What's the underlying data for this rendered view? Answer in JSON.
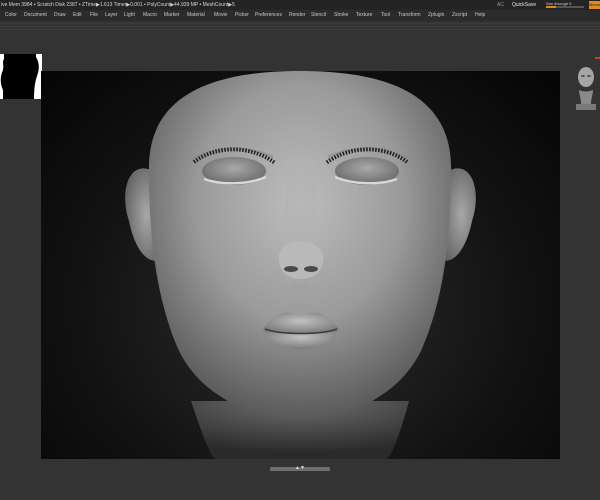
{
  "status_bar": {
    "text": "ive Mem 3984 • Scratch Disk 2387 • ZTime▶1.613 Timer▶0.001 • PolyCount▶44.939 MP • MeshCount▶5",
    "ac_label": "AC",
    "quicksave_label": "QuickSave",
    "see_through": {
      "label": "See-through",
      "value": "0",
      "level": 0.25
    },
    "menus_label": "Menus"
  },
  "menu": {
    "items": [
      {
        "label": "Color"
      },
      {
        "label": "Document"
      },
      {
        "label": "Draw"
      },
      {
        "label": "Edit"
      },
      {
        "label": "File"
      },
      {
        "label": "Layer"
      },
      {
        "label": "Light"
      },
      {
        "label": "Macro"
      },
      {
        "label": "Marker"
      },
      {
        "label": "Material"
      },
      {
        "label": "Movie"
      },
      {
        "label": "Picker"
      },
      {
        "label": "Preferences"
      },
      {
        "label": "Render"
      },
      {
        "label": "Stencil"
      },
      {
        "label": "Stroke"
      },
      {
        "label": "Texture"
      },
      {
        "label": "Tool"
      },
      {
        "label": "Transform"
      },
      {
        "label": "Zplugin"
      },
      {
        "label": "Zscript"
      },
      {
        "label": "Help"
      }
    ]
  },
  "icons": {
    "tool_thumbnail": "head-bust-icon",
    "bottom_arrows": "up-down-arrows-icon"
  },
  "colors": {
    "accent": "#e08a1e",
    "indicator": "#d9372a"
  }
}
